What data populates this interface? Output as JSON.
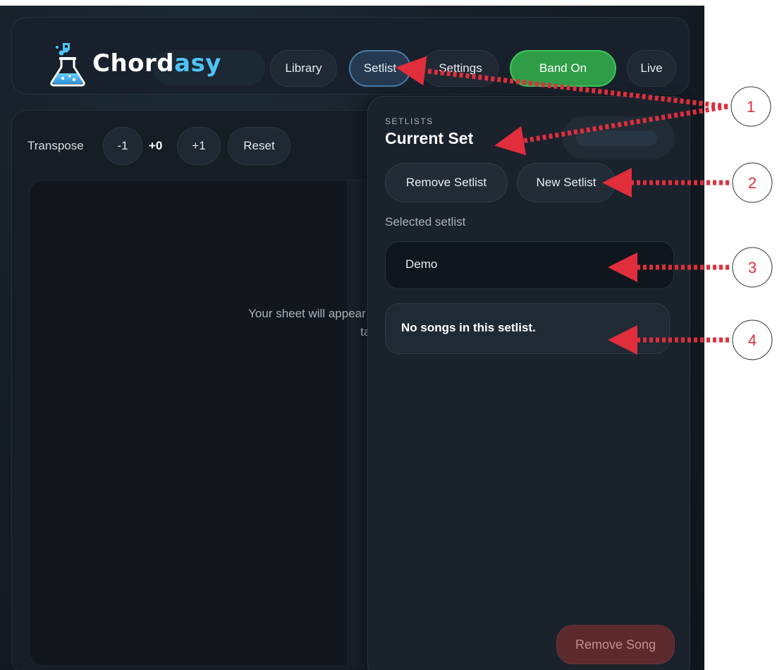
{
  "app": {
    "name_main": "Chord",
    "name_accent": "asy"
  },
  "nav": {
    "library": "Library",
    "setlist": "Setlist",
    "settings": "Settings",
    "band_on": "Band On",
    "live": "Live"
  },
  "transpose": {
    "label": "Transpose",
    "minus": "-1",
    "value": "+0",
    "plus": "+1",
    "reset": "Reset"
  },
  "sheet": {
    "placeholder_line1": "Your sheet will appear here in tablet layout",
    "placeholder_line2": "tablet layout"
  },
  "setlist_panel": {
    "eyebrow": "SETLISTS",
    "title": "Current Set",
    "remove_setlist": "Remove Setlist",
    "new_setlist": "New Setlist",
    "selected_label": "Selected setlist",
    "selected_value": "Demo",
    "empty_message": "No songs in this setlist.",
    "remove_song": "Remove Song"
  },
  "callouts": [
    "1",
    "2",
    "3",
    "4"
  ],
  "colors": {
    "accent": "#4fc3f7",
    "band_on": "#2f9d48",
    "annotation": "#e02e3c"
  }
}
